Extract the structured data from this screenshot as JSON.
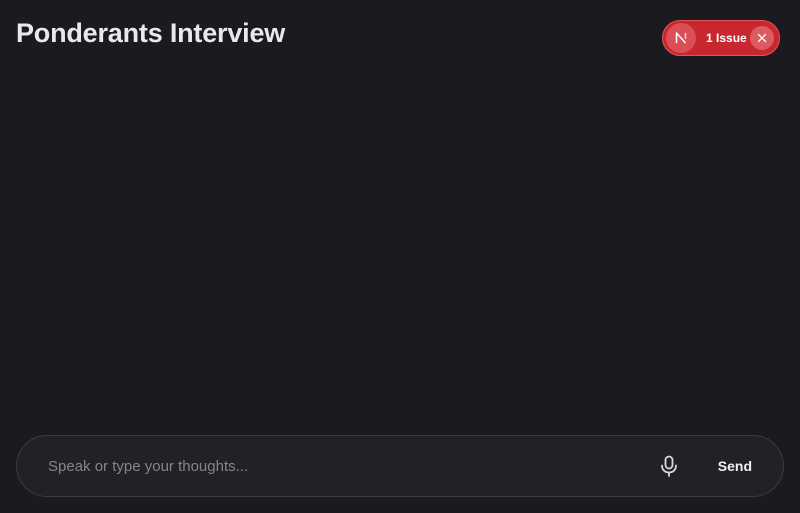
{
  "header": {
    "title": "Ponderants Interview"
  },
  "dev_indicator": {
    "logo_letter": "N",
    "issue_label": "1 Issue",
    "logo_icon": "next-logo-icon",
    "close_icon": "close-icon",
    "accent_color": "#c9272f"
  },
  "composer": {
    "placeholder": "Speak or type your thoughts...",
    "value": "",
    "mic_icon": "microphone-icon",
    "send_label": "Send"
  },
  "colors": {
    "background": "#1b1b1f",
    "input_background": "#222226",
    "input_border": "#3b3b40"
  }
}
